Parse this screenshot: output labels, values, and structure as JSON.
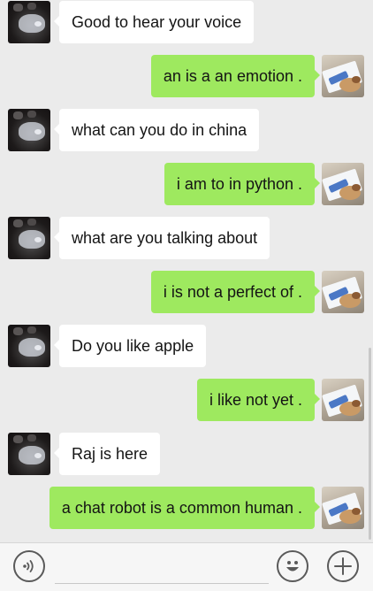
{
  "chat": {
    "messages": [
      {
        "side": "in",
        "text": "Good to hear your voice"
      },
      {
        "side": "out",
        "text": "an is a an emotion ."
      },
      {
        "side": "in",
        "text": "what can you do in china"
      },
      {
        "side": "out",
        "text": "i am to in python ."
      },
      {
        "side": "in",
        "text": "what are you talking about"
      },
      {
        "side": "out",
        "text": "i is not a perfect of ."
      },
      {
        "side": "in",
        "text": "Do you like apple"
      },
      {
        "side": "out",
        "text": "i like not yet ."
      },
      {
        "side": "in",
        "text": "Raj is here"
      },
      {
        "side": "out",
        "text": "a chat robot is a common human ."
      }
    ]
  },
  "input_bar": {
    "voice_icon": "voice-wave-icon",
    "emoji_icon": "smiley-face-icon",
    "plus_icon": "plus-icon",
    "text_value": ""
  },
  "colors": {
    "background": "#ebebeb",
    "incoming_bubble": "#ffffff",
    "outgoing_bubble": "#9ee95f",
    "icon": "#5a5a5a"
  }
}
